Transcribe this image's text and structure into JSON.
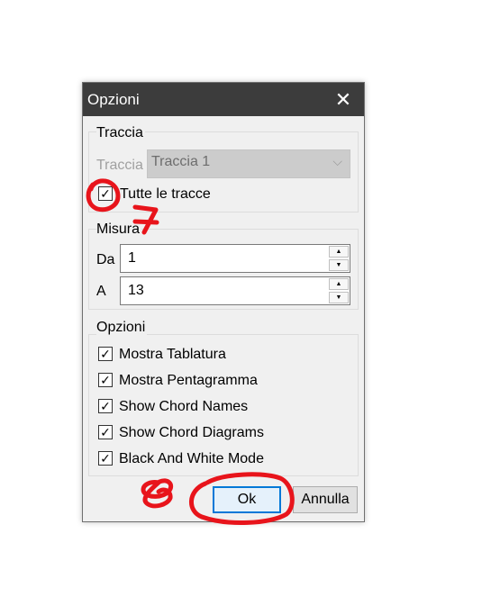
{
  "dialog": {
    "title": "Opzioni",
    "close_glyph": "✕"
  },
  "traccia_group": {
    "label": "Traccia",
    "track_label": "Traccia",
    "track_value": "Traccia 1",
    "dropdown_glyph": "⌵",
    "all_tracks_checked": true,
    "all_tracks_label": "Tutte le tracce"
  },
  "misura_group": {
    "label": "Misura",
    "from_label": "Da",
    "from_value": "1",
    "to_label": "A",
    "to_value": "13",
    "spin_up_glyph": "▲",
    "spin_down_glyph": "▼"
  },
  "options_group": {
    "label": "Opzioni",
    "check_glyph": "✓",
    "items": [
      {
        "label": "Mostra Tablatura",
        "checked": true
      },
      {
        "label": "Mostra Pentagramma",
        "checked": true
      },
      {
        "label": "Show Chord Names",
        "checked": true
      },
      {
        "label": "Show Chord Diagrams",
        "checked": true
      },
      {
        "label": "Black And White Mode",
        "checked": true
      }
    ]
  },
  "buttons": {
    "ok_label": "Ok",
    "cancel_label": "Annulla"
  },
  "colors": {
    "titlebar": "#3c3c3c",
    "dialog_bg": "#f0f0f0",
    "ok_border": "#0078d7",
    "annotation_red": "#e8141b"
  },
  "annotations": {
    "digit_near_checkbox": "7",
    "digit_near_ok": "8"
  }
}
